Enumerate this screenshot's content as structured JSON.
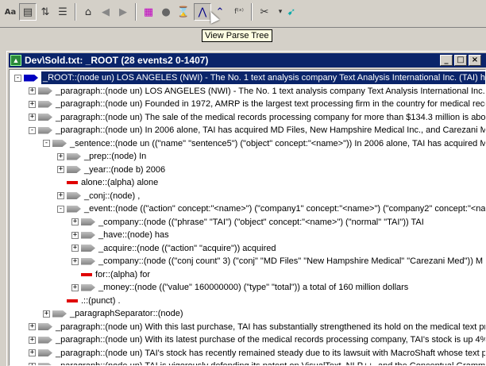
{
  "tooltip": "View Parse Tree",
  "window": {
    "title": "Dev\\Sold.txt: _ROOT (28 events2 0-1407)",
    "minimize": "_",
    "maximize": "□",
    "close": "×"
  },
  "tree": [
    {
      "lvl": 0,
      "exp": "-",
      "icon": "blue",
      "sel": true,
      "text": "_ROOT::(node un)   LOS ANGELES (NWI) - The No. 1 text analysis company Text Analysis International Inc. (TAI) has"
    },
    {
      "lvl": 1,
      "exp": "+",
      "icon": "gray",
      "text": "_paragraph::(node un)   LOS ANGELES (NWI) - The No. 1 text analysis company Text Analysis International Inc. (TAI) ha"
    },
    {
      "lvl": 1,
      "exp": "+",
      "icon": "gray",
      "text": "_paragraph::(node un)   Founded in 1972, AMRP is the largest text processing firm in the country for medical records"
    },
    {
      "lvl": 1,
      "exp": "+",
      "icon": "gray",
      "text": "_paragraph::(node un)   The sale of the medical records processing company for more than $134.3 million is above"
    },
    {
      "lvl": 1,
      "exp": "-",
      "icon": "gray",
      "text": "_paragraph::(node un)   In 2006 alone, TAI has acquired MD Files, New Hampshire Medical Inc., and Carezani Me"
    },
    {
      "lvl": 2,
      "exp": "-",
      "icon": "gray",
      "text": "_sentence::(node un ((\"name\" \"sentence5\") (\"object\" concept:\"<name>\"))   In 2006 alone, TAI has acquired M"
    },
    {
      "lvl": 3,
      "exp": "+",
      "icon": "gray",
      "text": "_prep::(node)   In"
    },
    {
      "lvl": 3,
      "exp": "+",
      "icon": "gray",
      "text": "_year::(node b)   2006"
    },
    {
      "lvl": 3,
      "exp": "",
      "icon": "red",
      "text": "alone::(alpha)   alone"
    },
    {
      "lvl": 3,
      "exp": "+",
      "icon": "gray",
      "text": "_conj::(node)   ,"
    },
    {
      "lvl": 3,
      "exp": "-",
      "icon": "gray",
      "text": "_event::(node ((\"action\" concept:\"<name>\") (\"company1\" concept:\"<name>\") (\"company2\" concept:\"<name"
    },
    {
      "lvl": 4,
      "exp": "+",
      "icon": "gray",
      "text": "_company::(node ((\"phrase\" \"TAI\") (\"object\" concept:\"<name>\") (\"normal\" \"TAI\"))   TAI"
    },
    {
      "lvl": 4,
      "exp": "+",
      "icon": "gray",
      "text": "_have::(node)   has"
    },
    {
      "lvl": 4,
      "exp": "+",
      "icon": "gray",
      "text": "_acquire::(node ((\"action\" \"acquire\"))   acquired"
    },
    {
      "lvl": 4,
      "exp": "+",
      "icon": "gray",
      "text": "_company::(node ((\"conj count\" 3) (\"conj\" \"MD Files\" \"New Hampshire Medical\" \"Carezani Med\"))   M"
    },
    {
      "lvl": 4,
      "exp": "",
      "icon": "red",
      "text": "for::(alpha)   for"
    },
    {
      "lvl": 4,
      "exp": "+",
      "icon": "gray",
      "text": "_money::(node ((\"value\" 160000000) (\"type\" \"total\"))   a total of 160 million dollars"
    },
    {
      "lvl": 3,
      "exp": "",
      "icon": "red",
      "text": ".::(punct)   ."
    },
    {
      "lvl": 2,
      "exp": "+",
      "icon": "gray",
      "text": "_paragraphSeparator::(node)"
    },
    {
      "lvl": 1,
      "exp": "+",
      "icon": "gray",
      "text": "_paragraph::(node un)   With this last purchase, TAI has substantially strengthened its hold on the medical text pro"
    },
    {
      "lvl": 1,
      "exp": "+",
      "icon": "gray",
      "text": "_paragraph::(node un)   With its latest purchase of the medical records processing company, TAI's stock is up 4%"
    },
    {
      "lvl": 1,
      "exp": "+",
      "icon": "gray",
      "text": "_paragraph::(node un)   TAI's stock has recently remained steady due to its lawsuit with MacroShaft whose text pr"
    },
    {
      "lvl": 1,
      "exp": "+",
      "icon": "gray",
      "text": "_paragraph::(node un)   TAI is vigorously defending its patent on VisualText, NLP++, and the Conceptual Gramma"
    }
  ]
}
